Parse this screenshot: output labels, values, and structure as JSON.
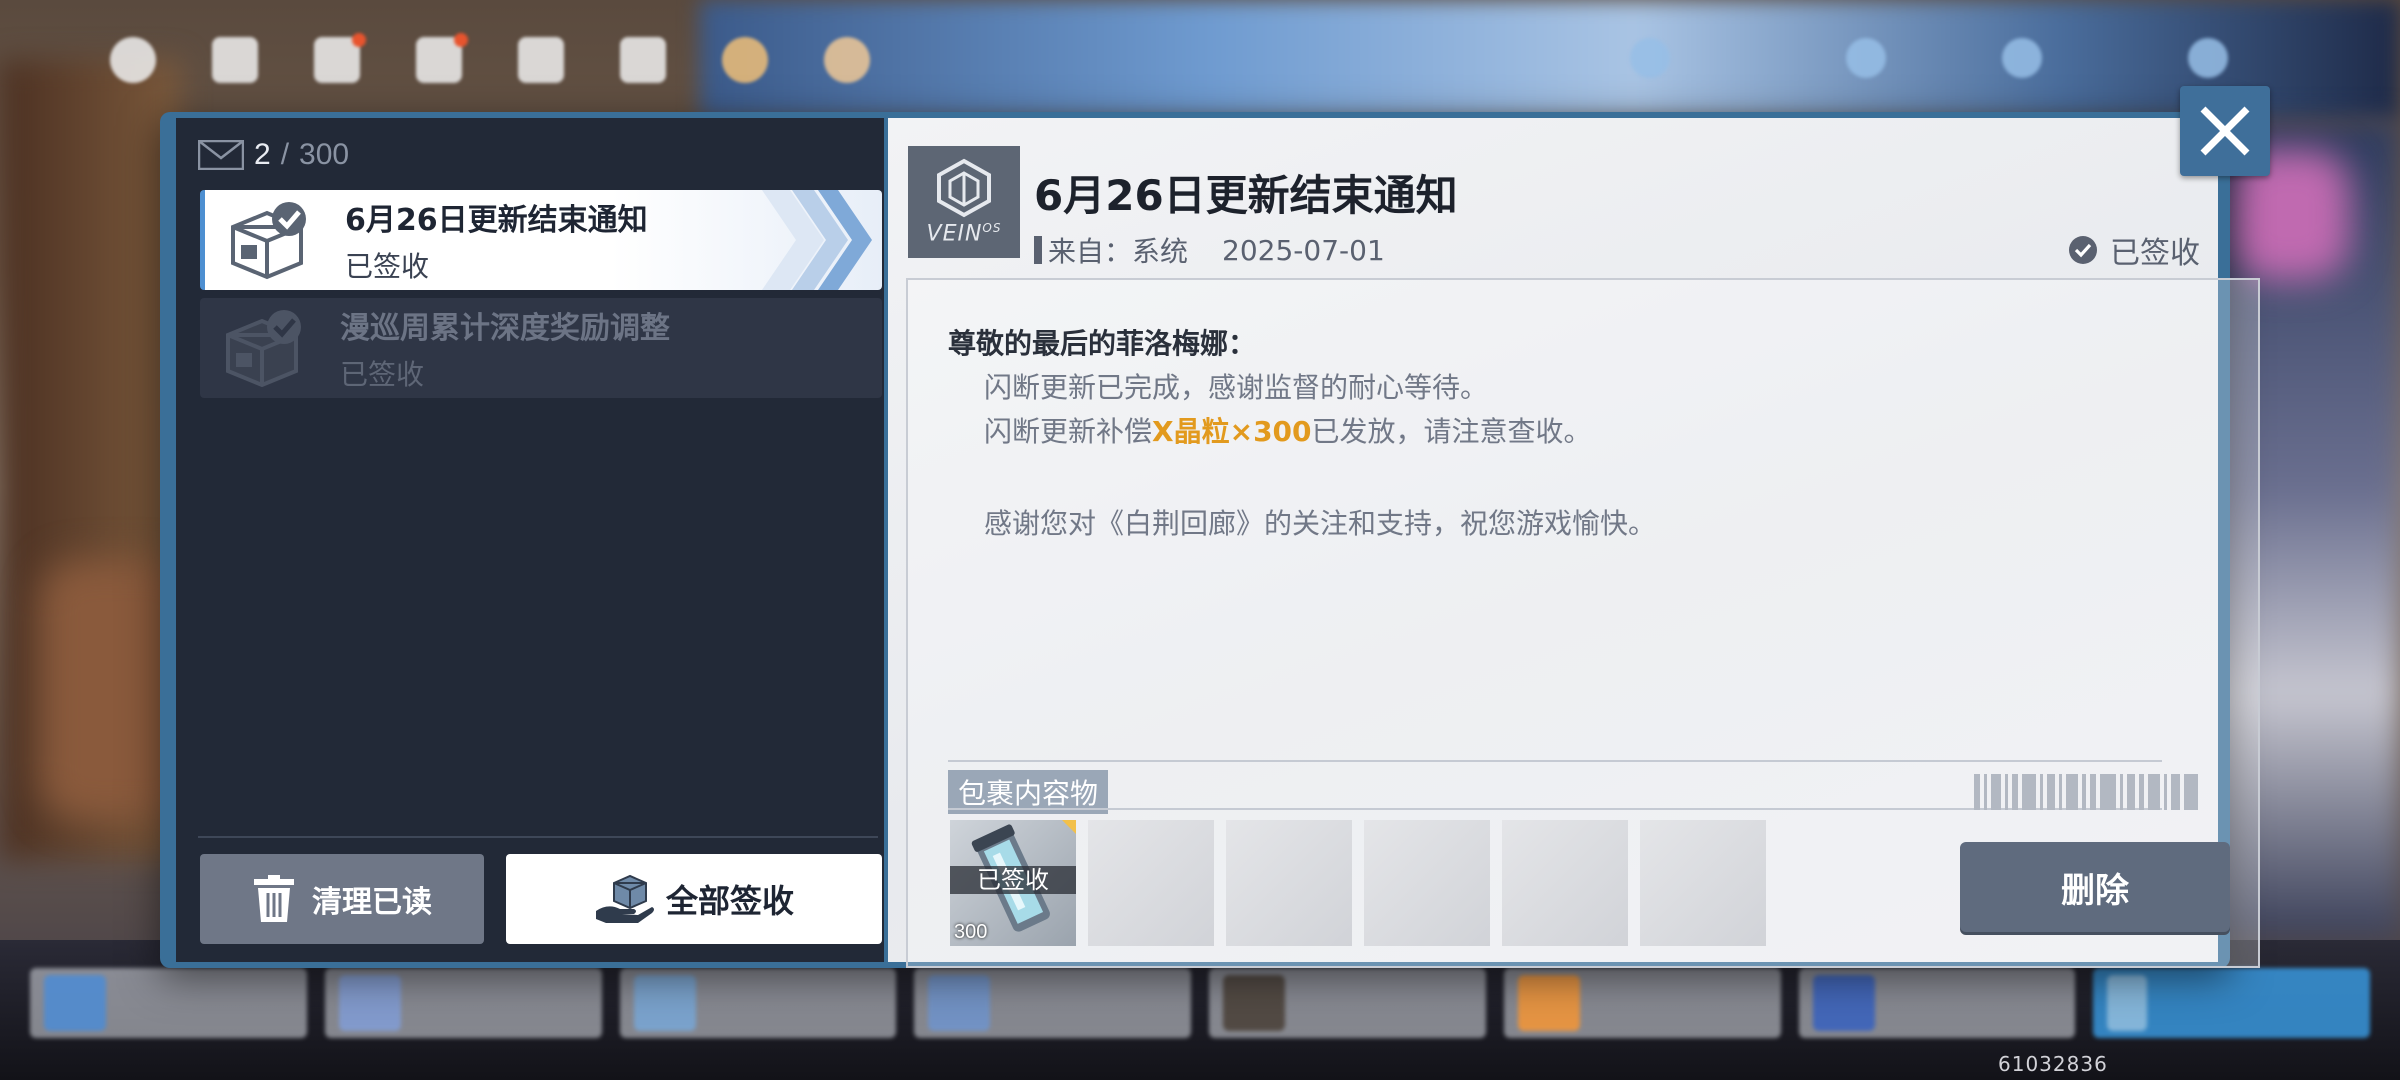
{
  "mailbox": {
    "count_current": "2",
    "count_separator": "/",
    "count_total": "300"
  },
  "mails": [
    {
      "title": "6月26日更新结束通知",
      "status": "已签收",
      "selected": true
    },
    {
      "title": "漫巡周累计深度奖励调整",
      "status": "已签收",
      "selected": false
    }
  ],
  "buttons": {
    "clear_read": "清理已读",
    "claim_all": "全部签收",
    "delete": "删除"
  },
  "detail": {
    "subject": "6月26日更新结束通知",
    "sender_label": "来自：",
    "sender": "系统",
    "date": "2025-07-01",
    "claimed_status": "已签收",
    "logo_text": "VEIN",
    "logo_sup": "OS",
    "greeting": "尊敬的最后的菲洛梅娜：",
    "line1": "闪断更新已完成，感谢监督的耐心等待。",
    "line2_prefix": "闪断更新补偿",
    "line2_highlight": "X晶粒×300",
    "line2_suffix": "已发放，请注意查收。",
    "line3": "感谢您对《白荆回廊》的关注和支持，祝您游戏愉快。",
    "attachments_label": "包裹内容物",
    "attachment": {
      "claimed_tag": "已签收",
      "qty": "300"
    }
  },
  "user_id": "61032836",
  "colors": {
    "accent_blue": "#3a6f98",
    "highlight": "#e29a1e",
    "list_bg": "#222937",
    "detail_bg": "#f2f3f5"
  }
}
